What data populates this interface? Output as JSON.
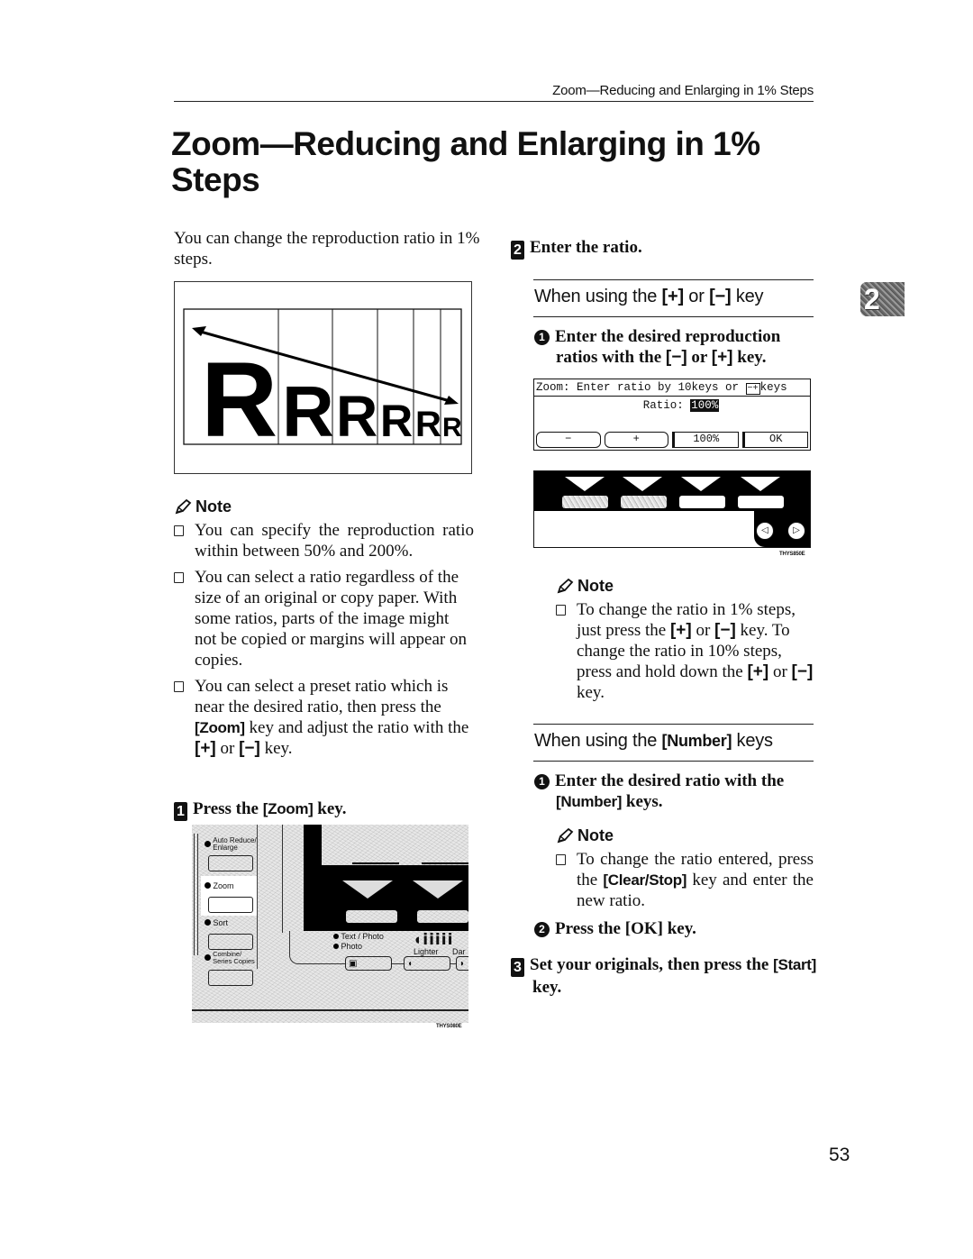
{
  "running_head": "Zoom—Reducing and Enlarging in 1% Steps",
  "title": "Zoom—Reducing and Enlarging in 1% Steps",
  "intro": "You can change the reproduction ratio in 1% steps.",
  "chapter_tab": "2",
  "page_number": "53",
  "figure_ratio": {
    "letters": [
      "R",
      "R",
      "R",
      "R",
      "R",
      "R"
    ]
  },
  "left_note": {
    "heading": "Note",
    "items": [
      {
        "text": "You can specify the reproduction ratio within between 50% and 200%."
      },
      {
        "text": "You can select a ratio regardless of the size of an original or copy paper. With some ratios, parts of the image might not be copied or margins will appear on copies."
      },
      {
        "pre": "You can select a preset ratio which is near the desired ratio, then press the ",
        "key1": "[Zoom]",
        "mid": " key and adjust the ratio with the ",
        "key2": "[+]",
        "mid2": " or ",
        "key3": "[−]",
        "post": " key."
      }
    ]
  },
  "step1": {
    "num": "1",
    "pre": "Press the ",
    "key": "[Zoom]",
    "post": " key."
  },
  "control_panel_figure": {
    "buttons": [
      {
        "label_line1": "Auto Reduce/",
        "label_line2": "Enlarge"
      },
      {
        "label_line1": "Zoom",
        "label_line2": ""
      },
      {
        "label_line1": "Sort",
        "label_line2": ""
      },
      {
        "label_line1": "Combine/",
        "label_line2": "Series Copies"
      }
    ],
    "mode_labels": [
      "Text / Photo",
      "Photo"
    ],
    "density_labels": [
      "Lighter",
      "Dar"
    ],
    "code": "THYS080E"
  },
  "step2": {
    "num": "2",
    "text": "Enter the ratio."
  },
  "section_plus_minus": {
    "heading_pre": "When using the ",
    "heading_key1": "[+]",
    "heading_mid": " or ",
    "heading_key2": "[−]",
    "heading_post": " key",
    "substep1": {
      "num": "1",
      "pre": "Enter the desired reproduction ratios with the ",
      "key1": "[−]",
      "mid": " or ",
      "key2": "[+]",
      "post": " key."
    }
  },
  "lcd_figure": {
    "top_line": "Zoom:  Enter ratio by 10keys or ",
    "top_keys": "−+",
    "top_suffix": "keys",
    "ratio_label": "Ratio:",
    "ratio_value": "100%",
    "buttons": [
      "−",
      "+",
      "100%",
      "OK"
    ],
    "code": "THYS850E"
  },
  "right_note_1": {
    "heading": "Note",
    "pre": "To change the ratio in 1% steps, just press the ",
    "key1": "[+]",
    "mid1": " or ",
    "key2": "[−]",
    "mid2": " key. To change the ratio in 10% steps, press and hold down the ",
    "key3": "[+]",
    "mid3": " or ",
    "key4": "[−]",
    "post": " key."
  },
  "section_number": {
    "heading_pre": "When using the ",
    "heading_key": "[Number]",
    "heading_post": " keys",
    "substep1": {
      "num": "1",
      "pre": "Enter the desired ratio with the ",
      "key": "[Number]",
      "post": " keys."
    },
    "note": {
      "heading": "Note",
      "pre": "To change the ratio entered, press the ",
      "key": "[Clear/Stop]",
      "post": " key and enter the new ratio."
    },
    "substep2": {
      "num": "2",
      "pre": "Press the ",
      "key": "[OK]",
      "post": " key."
    }
  },
  "step3": {
    "num": "3",
    "pre": "Set your originals, then press the ",
    "key": "[Start]",
    "post": " key."
  }
}
